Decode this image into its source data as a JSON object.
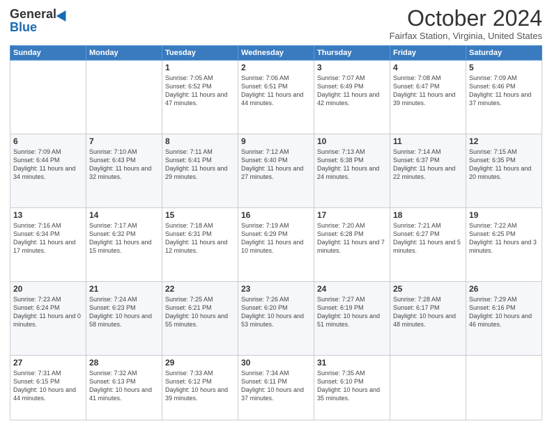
{
  "header": {
    "logo_general": "General",
    "logo_blue": "Blue",
    "month_title": "October 2024",
    "location": "Fairfax Station, Virginia, United States"
  },
  "days_of_week": [
    "Sunday",
    "Monday",
    "Tuesday",
    "Wednesday",
    "Thursday",
    "Friday",
    "Saturday"
  ],
  "weeks": [
    [
      {
        "day": "",
        "info": ""
      },
      {
        "day": "",
        "info": ""
      },
      {
        "day": "1",
        "info": "Sunrise: 7:05 AM\nSunset: 6:52 PM\nDaylight: 11 hours and 47 minutes."
      },
      {
        "day": "2",
        "info": "Sunrise: 7:06 AM\nSunset: 6:51 PM\nDaylight: 11 hours and 44 minutes."
      },
      {
        "day": "3",
        "info": "Sunrise: 7:07 AM\nSunset: 6:49 PM\nDaylight: 11 hours and 42 minutes."
      },
      {
        "day": "4",
        "info": "Sunrise: 7:08 AM\nSunset: 6:47 PM\nDaylight: 11 hours and 39 minutes."
      },
      {
        "day": "5",
        "info": "Sunrise: 7:09 AM\nSunset: 6:46 PM\nDaylight: 11 hours and 37 minutes."
      }
    ],
    [
      {
        "day": "6",
        "info": "Sunrise: 7:09 AM\nSunset: 6:44 PM\nDaylight: 11 hours and 34 minutes."
      },
      {
        "day": "7",
        "info": "Sunrise: 7:10 AM\nSunset: 6:43 PM\nDaylight: 11 hours and 32 minutes."
      },
      {
        "day": "8",
        "info": "Sunrise: 7:11 AM\nSunset: 6:41 PM\nDaylight: 11 hours and 29 minutes."
      },
      {
        "day": "9",
        "info": "Sunrise: 7:12 AM\nSunset: 6:40 PM\nDaylight: 11 hours and 27 minutes."
      },
      {
        "day": "10",
        "info": "Sunrise: 7:13 AM\nSunset: 6:38 PM\nDaylight: 11 hours and 24 minutes."
      },
      {
        "day": "11",
        "info": "Sunrise: 7:14 AM\nSunset: 6:37 PM\nDaylight: 11 hours and 22 minutes."
      },
      {
        "day": "12",
        "info": "Sunrise: 7:15 AM\nSunset: 6:35 PM\nDaylight: 11 hours and 20 minutes."
      }
    ],
    [
      {
        "day": "13",
        "info": "Sunrise: 7:16 AM\nSunset: 6:34 PM\nDaylight: 11 hours and 17 minutes."
      },
      {
        "day": "14",
        "info": "Sunrise: 7:17 AM\nSunset: 6:32 PM\nDaylight: 11 hours and 15 minutes."
      },
      {
        "day": "15",
        "info": "Sunrise: 7:18 AM\nSunset: 6:31 PM\nDaylight: 11 hours and 12 minutes."
      },
      {
        "day": "16",
        "info": "Sunrise: 7:19 AM\nSunset: 6:29 PM\nDaylight: 11 hours and 10 minutes."
      },
      {
        "day": "17",
        "info": "Sunrise: 7:20 AM\nSunset: 6:28 PM\nDaylight: 11 hours and 7 minutes."
      },
      {
        "day": "18",
        "info": "Sunrise: 7:21 AM\nSunset: 6:27 PM\nDaylight: 11 hours and 5 minutes."
      },
      {
        "day": "19",
        "info": "Sunrise: 7:22 AM\nSunset: 6:25 PM\nDaylight: 11 hours and 3 minutes."
      }
    ],
    [
      {
        "day": "20",
        "info": "Sunrise: 7:23 AM\nSunset: 6:24 PM\nDaylight: 11 hours and 0 minutes."
      },
      {
        "day": "21",
        "info": "Sunrise: 7:24 AM\nSunset: 6:23 PM\nDaylight: 10 hours and 58 minutes."
      },
      {
        "day": "22",
        "info": "Sunrise: 7:25 AM\nSunset: 6:21 PM\nDaylight: 10 hours and 55 minutes."
      },
      {
        "day": "23",
        "info": "Sunrise: 7:26 AM\nSunset: 6:20 PM\nDaylight: 10 hours and 53 minutes."
      },
      {
        "day": "24",
        "info": "Sunrise: 7:27 AM\nSunset: 6:19 PM\nDaylight: 10 hours and 51 minutes."
      },
      {
        "day": "25",
        "info": "Sunrise: 7:28 AM\nSunset: 6:17 PM\nDaylight: 10 hours and 48 minutes."
      },
      {
        "day": "26",
        "info": "Sunrise: 7:29 AM\nSunset: 6:16 PM\nDaylight: 10 hours and 46 minutes."
      }
    ],
    [
      {
        "day": "27",
        "info": "Sunrise: 7:31 AM\nSunset: 6:15 PM\nDaylight: 10 hours and 44 minutes."
      },
      {
        "day": "28",
        "info": "Sunrise: 7:32 AM\nSunset: 6:13 PM\nDaylight: 10 hours and 41 minutes."
      },
      {
        "day": "29",
        "info": "Sunrise: 7:33 AM\nSunset: 6:12 PM\nDaylight: 10 hours and 39 minutes."
      },
      {
        "day": "30",
        "info": "Sunrise: 7:34 AM\nSunset: 6:11 PM\nDaylight: 10 hours and 37 minutes."
      },
      {
        "day": "31",
        "info": "Sunrise: 7:35 AM\nSunset: 6:10 PM\nDaylight: 10 hours and 35 minutes."
      },
      {
        "day": "",
        "info": ""
      },
      {
        "day": "",
        "info": ""
      }
    ]
  ]
}
